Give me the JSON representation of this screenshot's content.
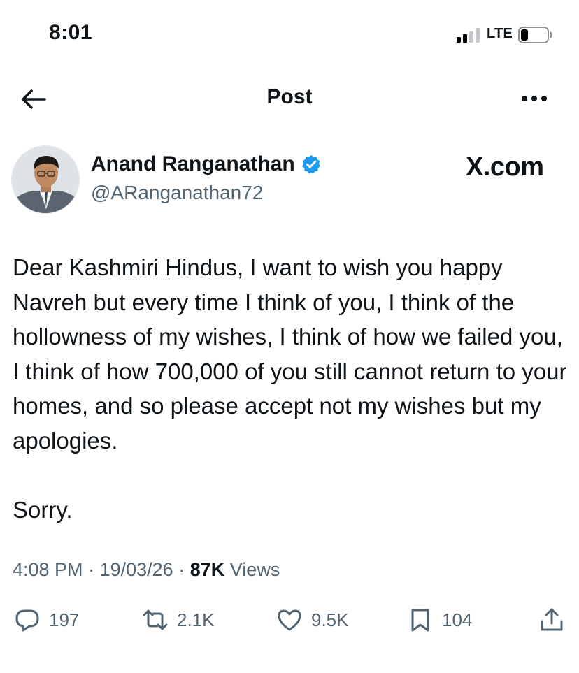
{
  "status_bar": {
    "time": "8:01",
    "network": "LTE",
    "signal_bars_filled": 2,
    "signal_bars_total": 4,
    "battery_level": 0.25
  },
  "nav": {
    "title": "Post",
    "back_icon": "arrow-left-icon",
    "more_icon": "more-horizontal-icon"
  },
  "author": {
    "name": "Anand Ranganathan",
    "handle": "@ARanganathan72",
    "verified": true
  },
  "watermark": "X.com",
  "post": {
    "text": "Dear Kashmiri Hindus, I want to wish you happy Navreh but every time I think of you, I think of the hollowness of my wishes, I think of how we failed you, I think of how 700,000 of you still cannot return to your homes, and so please accept not my wishes but my apologies.\n\nSorry."
  },
  "meta": {
    "time": "4:08 PM",
    "date": "19/03/26",
    "views_count": "87K",
    "views_label": "Views",
    "separator": "·"
  },
  "actions": {
    "replies": "197",
    "reposts": "2.1K",
    "likes": "9.5K",
    "bookmarks": "104"
  },
  "colors": {
    "text": "#0f1419",
    "secondary": "#536471",
    "verified": "#1d9bf0",
    "background": "#ffffff"
  }
}
